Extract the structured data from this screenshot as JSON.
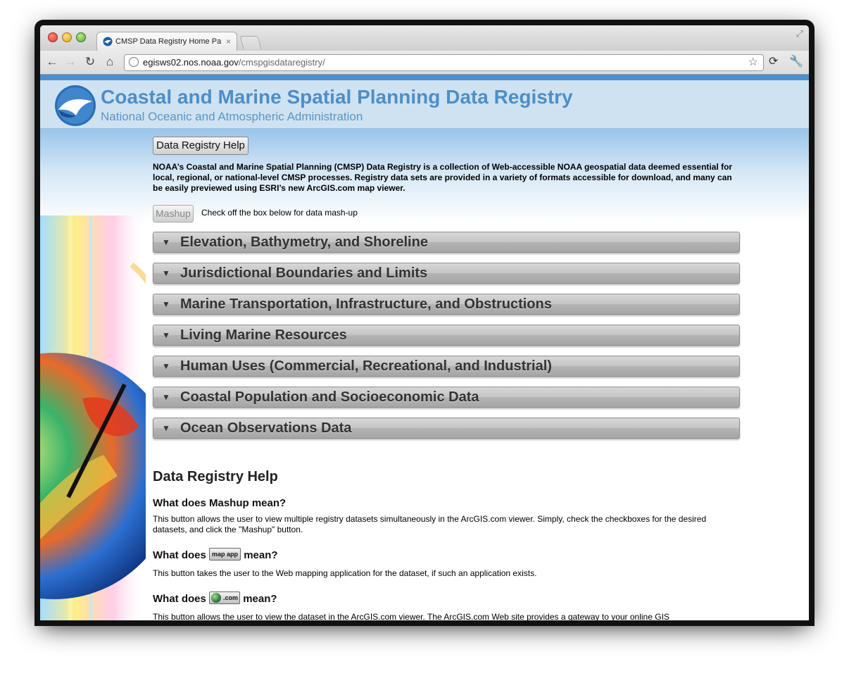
{
  "browser": {
    "tab_title": "CMSP Data Registry Home Pa",
    "tab_close": "×",
    "url_host": "egisws02.nos.noaa.gov",
    "url_path": "/cmspgisdataregistry/"
  },
  "header": {
    "title": "Coastal and Marine Spatial Planning Data Registry",
    "subtitle": "National Oceanic and Atmospheric Administration"
  },
  "toolbar": {
    "help_button": "Data Registry Help",
    "intro": "NOAA’s Coastal and Marine Spatial Planning (CMSP) Data Registry is a collection of Web-accessible NOAA geospatial data deemed essential for local, regional, or national-level CMSP processes. Registry data sets are provided in a variety of formats accessible for download, and many can be easily previewed using ESRI’s new ArcGIS.com map viewer.",
    "mashup_button": "Mashup",
    "mashup_note": "Check off the box below for data mash-up"
  },
  "sections": [
    {
      "label": "Elevation, Bathymetry, and Shoreline"
    },
    {
      "label": "Jurisdictional Boundaries and Limits"
    },
    {
      "label": "Marine Transportation, Infrastructure, and Obstructions"
    },
    {
      "label": "Living Marine Resources"
    },
    {
      "label": "Human Uses (Commercial, Recreational, and Industrial)"
    },
    {
      "label": "Coastal Population and Socioeconomic Data"
    },
    {
      "label": "Ocean Observations Data"
    }
  ],
  "help": {
    "title": "Data Registry Help",
    "q1": "What does Mashup mean?",
    "a1": "This button allows the user to view multiple registry datasets simultaneously in the ArcGIS.com viewer. Simply, check the checkboxes for the desired datasets, and click the \"Mashup\" button.",
    "q2_prefix": "What does",
    "q2_button": "map app",
    "q2_suffix": "mean?",
    "a2": "This button takes the user to the Web mapping application for the dataset, if such an application exists.",
    "q3_prefix": "What does",
    "q3_button": ".com",
    "q3_suffix": "mean?",
    "a3": "This button allows the user to view the dataset in the ArcGIS.com viewer.  The ArcGIS.com Web site provides a gateway to your online GIS"
  },
  "icons": {
    "tab_favicon": "noaa-logo-icon",
    "back": "back-arrow-icon",
    "forward": "forward-arrow-icon",
    "reload": "reload-icon",
    "home": "home-icon",
    "bookmark": "star-icon",
    "extension": "extension-icon",
    "settings": "wrench-icon",
    "section_toggle": "triangle-down-icon"
  },
  "colors": {
    "title_blue": "#4c8fc7",
    "header_bg": "#cfe2f1",
    "header_border": "#4a90cf"
  }
}
